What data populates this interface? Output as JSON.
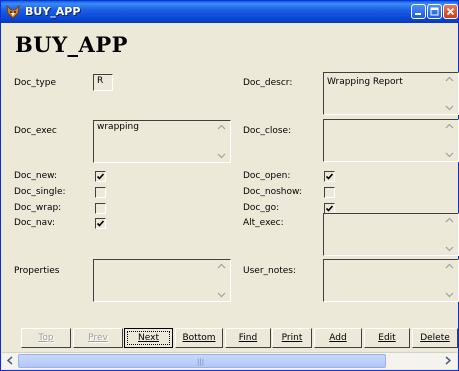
{
  "window": {
    "title": "BUY_APP",
    "icon": "fox-app-icon",
    "controls": [
      "minimize",
      "maximize",
      "close"
    ]
  },
  "heading": "BUY_APP",
  "fields": {
    "doc_type": {
      "label": "Doc_type",
      "value": "R"
    },
    "doc_descr": {
      "label": "Doc_descr:",
      "value": "Wrapping Report"
    },
    "doc_exec": {
      "label": "Doc_exec",
      "value": "wrapping"
    },
    "doc_close": {
      "label": "Doc_close:",
      "value": ""
    },
    "alt_exec": {
      "label": "Alt_exec:",
      "value": ""
    },
    "properties": {
      "label": "Properties",
      "value": ""
    },
    "user_notes": {
      "label": "User_notes:",
      "value": ""
    }
  },
  "checkboxes": {
    "doc_new": {
      "label": "Doc_new:",
      "checked": true
    },
    "doc_single": {
      "label": "Doc_single:",
      "checked": false
    },
    "doc_wrap": {
      "label": "Doc_wrap:",
      "checked": false
    },
    "doc_nav": {
      "label": "Doc_nav:",
      "checked": true
    },
    "doc_open": {
      "label": "Doc_open:",
      "checked": true
    },
    "doc_noshow": {
      "label": "Doc_noshow:",
      "checked": false
    },
    "doc_go": {
      "label": "Doc_go:",
      "checked": true
    }
  },
  "nav_buttons": {
    "top": {
      "label": "Top",
      "enabled": false
    },
    "prev": {
      "label": "Prev",
      "enabled": false
    },
    "next": {
      "label": "Next",
      "enabled": true
    },
    "bottom": {
      "label": "Bottom",
      "enabled": true
    },
    "find": {
      "label": "Find",
      "enabled": true
    },
    "print": {
      "label": "Print",
      "enabled": true
    },
    "add": {
      "label": "Add",
      "enabled": true
    },
    "edit": {
      "label": "Edit",
      "enabled": true
    },
    "delete": {
      "label": "Delete",
      "enabled": true
    }
  },
  "colors": {
    "titlebar": "#0a46d3",
    "window_bg": "#ece9d8",
    "scroll_thumb": "#b1c8f6"
  }
}
